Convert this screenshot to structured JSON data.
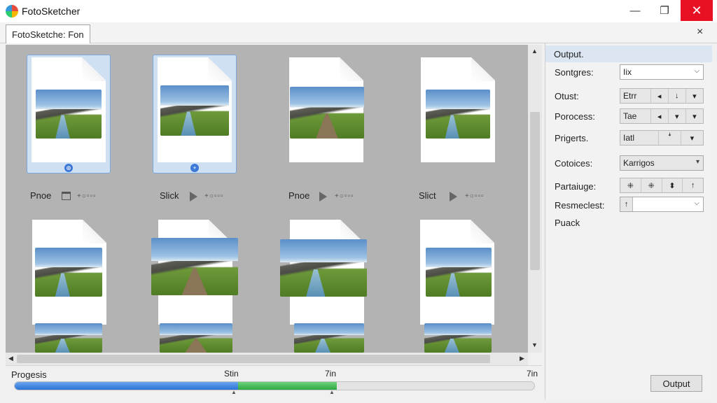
{
  "window": {
    "title": "FotoSketcher",
    "min_icon": "minimize-icon",
    "max_icon": "maximize-icon",
    "close_icon": "close-icon"
  },
  "tab": {
    "label": "FotoSketche: Fon",
    "close_glyph": "×"
  },
  "gallery": {
    "row1": [
      {
        "caption": "Pnoe",
        "icon": "folder-icon",
        "selected": true,
        "badge": "⊕",
        "photo": "river"
      },
      {
        "caption": "Slick",
        "icon": "play-icon",
        "selected": true,
        "badge": "+",
        "photo": "river"
      },
      {
        "caption": "Pnoe",
        "icon": "play-icon",
        "selected": false,
        "photo": "road"
      },
      {
        "caption": "Slict",
        "icon": "play-icon",
        "selected": false,
        "photo": "river"
      }
    ],
    "caption_dots": "+○▫▫▫"
  },
  "progress": {
    "label": "Progesis",
    "marks": [
      "Stin",
      "7in",
      "7in"
    ],
    "blue_fraction": 0.43,
    "green_fraction": 0.19
  },
  "panel": {
    "header": "Output.",
    "rows": [
      {
        "label": "Sontgres:",
        "type": "combo",
        "value": "Iix"
      },
      {
        "label": "Otust:",
        "type": "tools",
        "value": "Etrr",
        "cells": [
          "◂",
          "↓",
          "▾"
        ]
      },
      {
        "label": "Porocess:",
        "type": "tools",
        "value": "Tae",
        "cells": [
          "◂",
          "▾",
          "▾"
        ]
      },
      {
        "label": "Prigerts.",
        "type": "tools",
        "value": "Iatl",
        "cells": [
          "ꜜ",
          "▾"
        ]
      },
      {
        "label": "Cotoices:",
        "type": "combo-gray",
        "value": "Karrigos"
      },
      {
        "label": "Partaiuge:",
        "type": "icons",
        "cells": [
          "⁜",
          "⁜",
          "⬍",
          "↑"
        ]
      },
      {
        "label": "Resmeclest:",
        "type": "combo-arrow",
        "value": ""
      },
      {
        "label": "Puack",
        "type": "label"
      }
    ],
    "output_button": "Output"
  }
}
